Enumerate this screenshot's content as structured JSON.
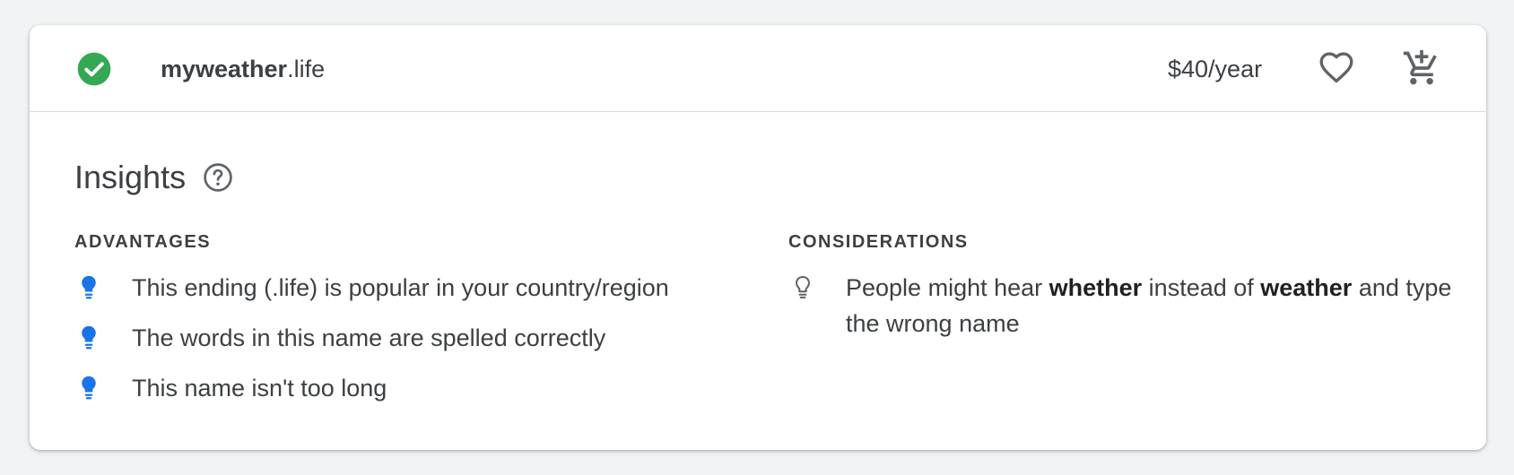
{
  "result": {
    "status_icon": "check-circle-icon",
    "status_color": "#34a853",
    "domain_sld": "myweather",
    "domain_tld": ".life",
    "price": "$40/year",
    "favorite_icon": "heart-outline-icon",
    "cart_icon": "add-shopping-cart-icon"
  },
  "insights": {
    "title": "Insights",
    "help_icon": "help-circle-icon",
    "advantages": {
      "heading": "ADVANTAGES",
      "icon": "lightbulb-filled-icon",
      "icon_color": "#1a73e8",
      "items": [
        "This ending (.life) is popular in your country/region",
        "The words in this name are spelled correctly",
        "This name isn't too long"
      ]
    },
    "considerations": {
      "heading": "CONSIDERATIONS",
      "icon": "lightbulb-outline-icon",
      "items": [
        {
          "p1": "People might hear ",
          "b1": "whether",
          "p2": " instead of ",
          "b2": "weather",
          "p3": " and type the wrong name"
        }
      ]
    }
  }
}
